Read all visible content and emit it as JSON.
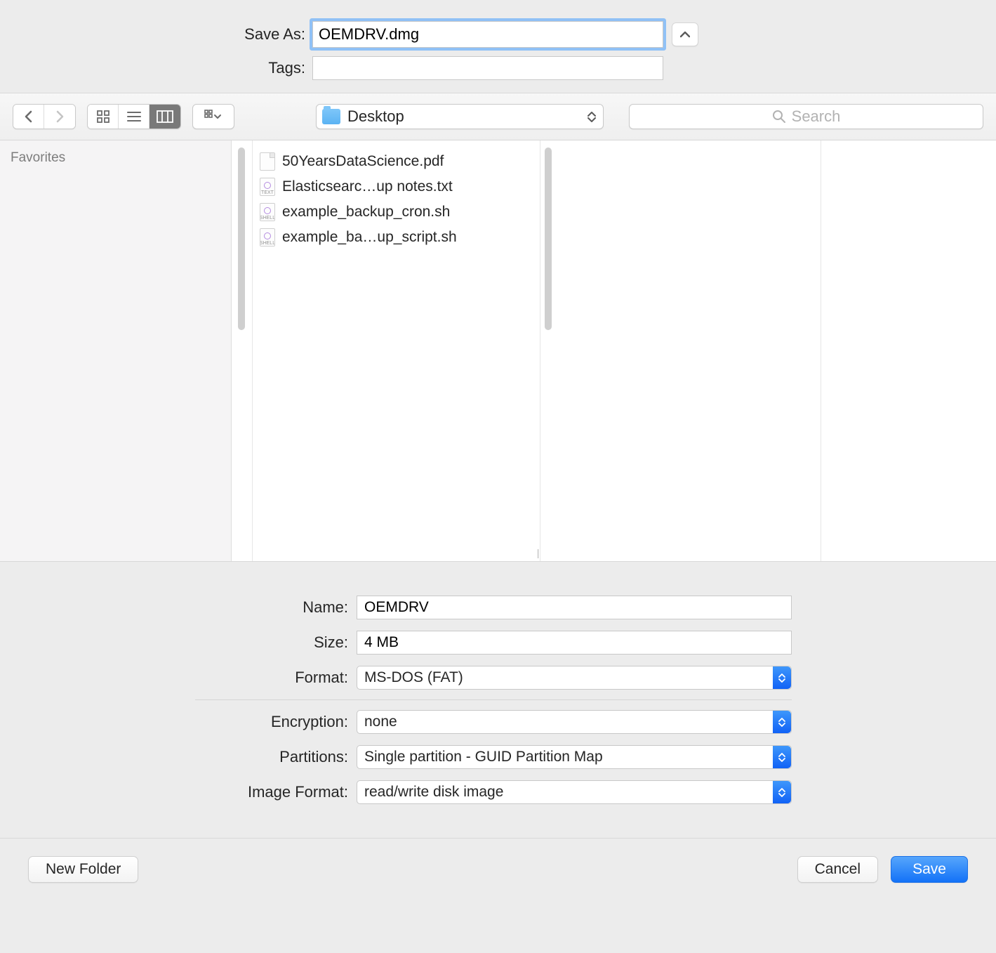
{
  "header": {
    "save_as_label": "Save As:",
    "save_as_value": "OEMDRV.dmg",
    "tags_label": "Tags:",
    "tags_value": ""
  },
  "toolbar": {
    "location": "Desktop",
    "search_placeholder": "Search"
  },
  "sidebar": {
    "favorites_heading": "Favorites"
  },
  "files": [
    {
      "name": "50YearsDataScience.pdf",
      "badge": ""
    },
    {
      "name": "Elasticsearc…up notes.txt",
      "badge": "TEXT"
    },
    {
      "name": "example_backup_cron.sh",
      "badge": "SHELL"
    },
    {
      "name": "example_ba…up_script.sh",
      "badge": "SHELL"
    }
  ],
  "options": {
    "name_label": "Name:",
    "name_value": "OEMDRV",
    "size_label": "Size:",
    "size_value": "4 MB",
    "format_label": "Format:",
    "format_value": "MS-DOS (FAT)",
    "encryption_label": "Encryption:",
    "encryption_value": "none",
    "partitions_label": "Partitions:",
    "partitions_value": "Single partition - GUID Partition Map",
    "image_format_label": "Image Format:",
    "image_format_value": "read/write disk image"
  },
  "buttons": {
    "new_folder": "New Folder",
    "cancel": "Cancel",
    "save": "Save"
  }
}
